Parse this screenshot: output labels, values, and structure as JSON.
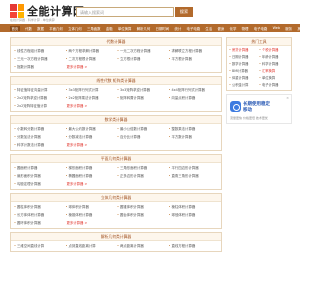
{
  "header": {
    "logo_text": "全能计算网",
    "logo_sub": "在线计算器 · 科学计算 · 单位换算",
    "search_placeholder": "请输入搜索词",
    "search_button": "搜索"
  },
  "nav": [
    "首页",
    "代数",
    "数据",
    "平面几何",
    "立体几何",
    "三角函数",
    "金融",
    "单位换算",
    "解析几何",
    "日期时间",
    "统计",
    "电子电路",
    "生活",
    "健身",
    "化学",
    "物理",
    "电子电路",
    "Web",
    "服务",
    "其他"
  ],
  "sections": [
    {
      "title": "代数计算器",
      "items": [
        "线性方程组计算器",
        "两个方程求解计算器",
        "一元二次方程计算器",
        "求解联立方程计算器",
        "三元一次方程计算器",
        "二次方程根计算器",
        "立方根计算器",
        "平方根计算器",
        "指数计算器",
        "更多计算器 >"
      ]
    },
    {
      "title": "线性代数 矩阵类计算器",
      "items": [
        "特征值特征向量计算",
        "3x3矩阵行列式计算",
        "3x3矩阵求逆计算器",
        "4x4矩阵行列式计算器",
        "2x2矩阵求逆计算器",
        "2x2矩阵乘法计算器",
        "矩阵转置计算器",
        "向量点积计算器",
        "2x2矩阵特征值计算",
        "更多计算器 >"
      ]
    },
    {
      "title": "数学类计算器",
      "items": [
        "小数转分数计算器",
        "最大公约数计算器",
        "最小公倍数计算器",
        "整数乘法计算器",
        "分数加法计算器",
        "分数减法计算器",
        "百分比计算器",
        "平方数计算器",
        "科学计数法计算器",
        "更多计算器 >"
      ]
    },
    {
      "title": "平面几何类计算器",
      "items": [
        "圆面积计算器",
        "梯形面积计算器",
        "三角形面积计算器",
        "平行四边形计算器",
        "扇形面积计算器",
        "椭圆面积计算器",
        "正多边形计算器",
        "直角三角形计算器",
        "勾股定理计算器",
        "更多计算器 >"
      ]
    },
    {
      "title": "立体几何类计算器",
      "items": [
        "圆柱体积计算器",
        "球体积计算器",
        "圆锥体积计算器",
        "棱柱体积计算器",
        "长方体体积计算器",
        "棱锥体积计算器",
        "圆台体积计算器",
        "球冠体积计算器",
        "圆环体积计算器",
        "更多计算器 >"
      ]
    },
    {
      "title": "解析几何类计算器",
      "items": [
        "三维空间直线计算",
        "点到直线距离计算",
        "两点距离计算器",
        "直线方程计算器"
      ]
    }
  ],
  "side": {
    "title": "热门工具",
    "items": [
      {
        "label": "房贷计算器",
        "hot": true
      },
      {
        "label": "个税计算器",
        "hot": true
      },
      {
        "label": "日期计算器",
        "hot": false
      },
      {
        "label": "年龄计算器",
        "hot": false
      },
      {
        "label": "数学计算器",
        "hot": false
      },
      {
        "label": "科学计算器",
        "hot": false
      },
      {
        "label": "BMI计算器",
        "hot": false
      },
      {
        "label": "汇率换算",
        "hot": true
      },
      {
        "label": "体重计算器",
        "hot": false
      },
      {
        "label": "单位换算",
        "hot": false
      },
      {
        "label": "公积金计算",
        "hot": false
      },
      {
        "label": "电子计算器",
        "hot": false
      }
    ]
  },
  "ad": {
    "title": "长期使用稳定",
    "title2": "移动",
    "desc": "流量更快 价格更低 技术更优",
    "close": "×"
  },
  "colors": {
    "brand": "#b26a2c",
    "accent": "#e0332a"
  }
}
